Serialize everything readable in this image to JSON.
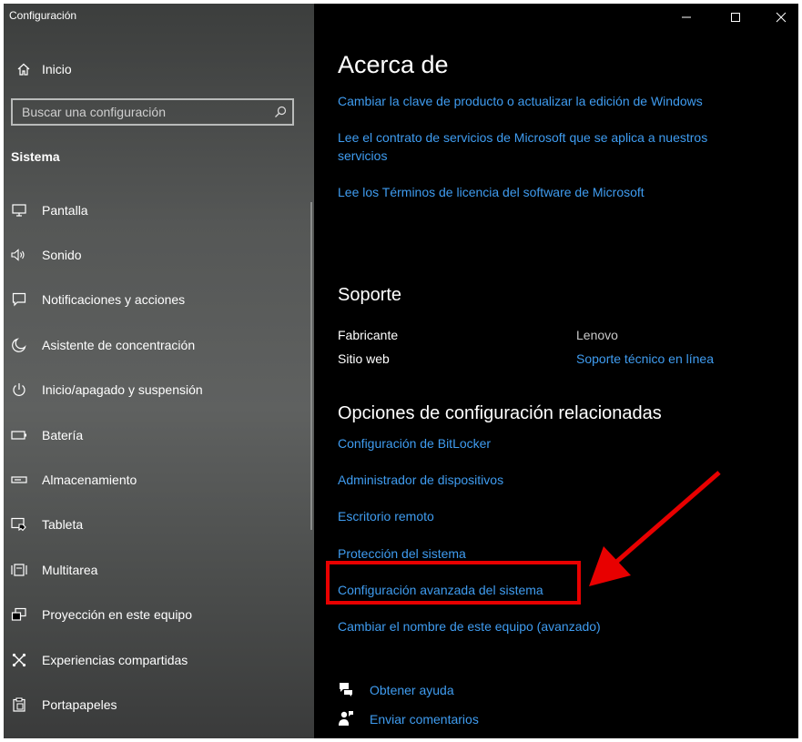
{
  "window": {
    "title": "Configuración"
  },
  "sidebar": {
    "home_label": "Inicio",
    "search_placeholder": "Buscar una configuración",
    "section_title": "Sistema",
    "items": [
      {
        "label": "Pantalla",
        "icon": "monitor-icon"
      },
      {
        "label": "Sonido",
        "icon": "speaker-icon"
      },
      {
        "label": "Notificaciones y acciones",
        "icon": "notification-icon"
      },
      {
        "label": "Asistente de concentración",
        "icon": "moon-icon"
      },
      {
        "label": "Inicio/apagado y suspensión",
        "icon": "power-icon"
      },
      {
        "label": "Batería",
        "icon": "battery-icon"
      },
      {
        "label": "Almacenamiento",
        "icon": "storage-icon"
      },
      {
        "label": "Tableta",
        "icon": "tablet-icon"
      },
      {
        "label": "Multitarea",
        "icon": "multitask-icon"
      },
      {
        "label": "Proyección en este equipo",
        "icon": "projection-icon"
      },
      {
        "label": "Experiencias compartidas",
        "icon": "shared-experiences-icon"
      },
      {
        "label": "Portapapeles",
        "icon": "clipboard-icon"
      }
    ]
  },
  "main": {
    "title": "Acerca de",
    "about_links": [
      "Cambiar la clave de producto o actualizar la edición de Windows",
      "Lee el contrato de servicios de Microsoft que se aplica a nuestros servicios",
      "Lee los Términos de licencia del software de Microsoft"
    ],
    "support": {
      "title": "Soporte",
      "manufacturer_label": "Fabricante",
      "manufacturer_value": "Lenovo",
      "website_label": "Sitio web",
      "website_value": "Soporte técnico en línea"
    },
    "related": {
      "title": "Opciones de configuración relacionadas",
      "links": [
        "Configuración de BitLocker",
        "Administrador de dispositivos",
        "Escritorio remoto",
        "Protección del sistema",
        "Configuración avanzada del sistema",
        "Cambiar el nombre de este equipo (avanzado)"
      ]
    },
    "help": {
      "get_help": "Obtener ayuda",
      "send_feedback": "Enviar comentarios"
    }
  },
  "colors": {
    "link": "#3f9cf0",
    "highlight": "#e80000",
    "background": "#000000"
  }
}
